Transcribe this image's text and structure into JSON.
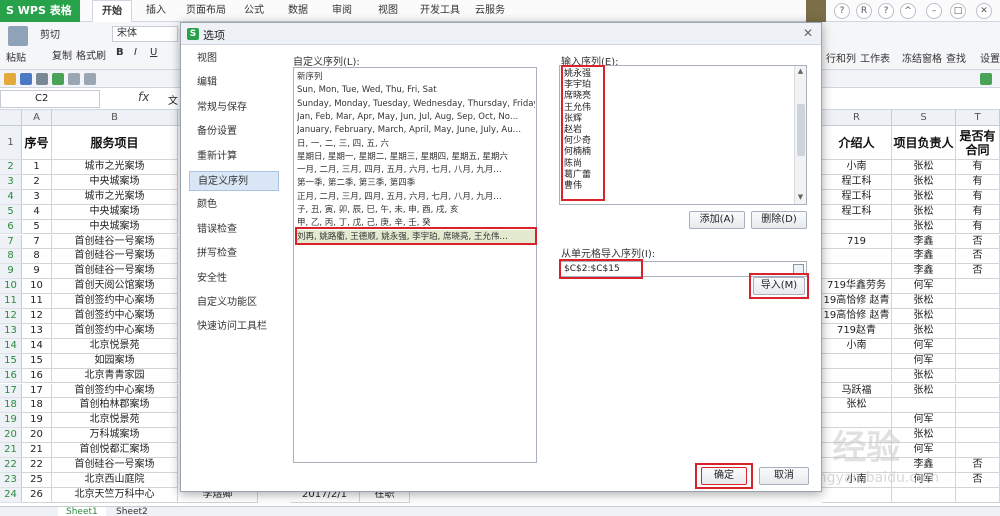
{
  "app": {
    "logo": "S WPS 表格",
    "tabs": [
      "开始",
      "插入",
      "页面布局",
      "公式",
      "数据",
      "审阅",
      "视图",
      "开发工具",
      "云服务"
    ],
    "active_tab": "开始"
  },
  "window": {
    "controls": [
      "?",
      "R",
      "?",
      "^",
      "–",
      "□",
      "✕"
    ]
  },
  "ribbon": {
    "paste": "粘贴",
    "cut": "剪切",
    "copy": "复制",
    "format_painter": "格式刷",
    "font": "宋体",
    "bold": "B",
    "italic": "I",
    "underline": "U",
    "right": [
      "行和列",
      "工作表",
      "冻结窗格",
      "查找",
      "设置"
    ]
  },
  "formula": {
    "namebox": "C2",
    "fx": "fx",
    "content": "文"
  },
  "grid": {
    "columns": [
      "A",
      "B",
      "R",
      "S",
      "T"
    ],
    "row_numbers": [
      "1",
      "2",
      "3",
      "4",
      "5",
      "6",
      "7",
      "8",
      "9",
      "10",
      "11",
      "12",
      "13",
      "14",
      "15",
      "16",
      "17",
      "18",
      "19",
      "20",
      "21",
      "22",
      "23",
      "24"
    ],
    "header": {
      "seq": "序号",
      "service": "服务项目",
      "referrer": "介绍人",
      "owner": "项目负责人",
      "contract": "是否有合同"
    },
    "rows": [
      {
        "seq": "1",
        "service": "城市之光案场",
        "ref": "小南",
        "owner": "张松",
        "c": "有"
      },
      {
        "seq": "2",
        "service": "中央城案场",
        "ref": "程工科",
        "owner": "张松",
        "c": "有"
      },
      {
        "seq": "3",
        "service": "城市之光案场",
        "ref": "程工科",
        "owner": "张松",
        "c": "有"
      },
      {
        "seq": "4",
        "service": "中央城案场",
        "ref": "程工科",
        "owner": "张松",
        "c": "有"
      },
      {
        "seq": "5",
        "service": "中央城案场",
        "ref": "",
        "owner": "张松",
        "c": "有"
      },
      {
        "seq": "7",
        "service": "首创硅谷一号案场",
        "ref": "719",
        "owner": "李鑫",
        "c": "否"
      },
      {
        "seq": "8",
        "service": "首创硅谷一号案场",
        "ref": "",
        "owner": "李鑫",
        "c": "否"
      },
      {
        "seq": "9",
        "service": "首创硅谷一号案场",
        "ref": "",
        "owner": "李鑫",
        "c": "否"
      },
      {
        "seq": "10",
        "service": "首创天阅公馆案场",
        "ref": "719华鑫劳务",
        "owner": "何军",
        "c": ""
      },
      {
        "seq": "11",
        "service": "首创签约中心案场",
        "ref": "19高恰修 赵青",
        "owner": "张松",
        "c": ""
      },
      {
        "seq": "12",
        "service": "首创签约中心案场",
        "ref": "19高恰修 赵青",
        "owner": "张松",
        "c": ""
      },
      {
        "seq": "13",
        "service": "首创签约中心案场",
        "ref": "719赵青",
        "owner": "张松",
        "c": ""
      },
      {
        "seq": "14",
        "service": "北京悦景苑",
        "ref": "小南",
        "owner": "何军",
        "c": ""
      },
      {
        "seq": "15",
        "service": "如园案场",
        "ref": "",
        "owner": "何军",
        "c": ""
      },
      {
        "seq": "16",
        "service": "北京青青家园",
        "ref": "",
        "owner": "张松",
        "c": ""
      },
      {
        "seq": "17",
        "service": "首创签约中心案场",
        "ref": "马跃福",
        "owner": "张松",
        "c": ""
      },
      {
        "seq": "18",
        "service": "首创柏林郡案场",
        "ref": "张松",
        "owner": "",
        "c": ""
      },
      {
        "seq": "19",
        "service": "北京悦景苑",
        "ref": "",
        "owner": "何军",
        "c": ""
      },
      {
        "seq": "20",
        "service": "万科城案场",
        "ref": "",
        "owner": "张松",
        "c": ""
      },
      {
        "seq": "21",
        "service": "首创悦都汇案场",
        "ref": "",
        "owner": "何军",
        "c": ""
      },
      {
        "seq": "22",
        "service": "首创硅谷一号案场",
        "ref": "",
        "owner": "李鑫",
        "c": "否"
      },
      {
        "seq": "25",
        "service": "北京西山庭院",
        "ref": "小南",
        "owner": "何军",
        "c": "否"
      },
      {
        "seq": "26",
        "service": "北京天竺万科中心",
        "ref": "",
        "owner": "",
        "c": ""
      }
    ],
    "partial_row": {
      "name": "李煜卿",
      "date": "2017/2/1",
      "status": "在职"
    }
  },
  "sheets": [
    "Sheet1",
    "Sheet2"
  ],
  "dialog": {
    "title": "选项",
    "nav": [
      "视图",
      "编辑",
      "常规与保存",
      "备份设置",
      "重新计算",
      "自定义序列",
      "颜色",
      "错误检查",
      "拼写检查",
      "安全性",
      "自定义功能区",
      "快速访问工具栏"
    ],
    "active_nav": "自定义序列",
    "custom_list_label": "自定义序列(L):",
    "custom_lists": [
      "新序列",
      "Sun, Mon, Tue, Wed, Thu, Fri, Sat",
      "Sunday, Monday, Tuesday, Wednesday, Thursday, Friday…",
      "Jan, Feb, Mar, Apr, May, Jun, Jul, Aug, Sep, Oct, No…",
      "January, February, March, April, May, June, July, Au…",
      "日, 一, 二, 三, 四, 五, 六",
      "星期日, 星期一, 星期二, 星期三, 星期四, 星期五, 星期六",
      "一月, 二月, 三月, 四月, 五月, 六月, 七月, 八月, 九月…",
      "第一季, 第二季, 第三季, 第四季",
      "正月, 二月, 三月, 四月, 五月, 六月, 七月, 八月, 九月…",
      "子, 丑, 寅, 卯, 辰, 巳, 午, 未, 申, 酉, 戌, 亥",
      "甲, 乙, 丙, 丁, 戊, 己, 庚, 辛, 壬, 癸",
      "刘再, 姚路衢, 王德顺, 姚永强, 李宇珀, 席晓亮, 王允伟…"
    ],
    "selected_list_index": 12,
    "input_label": "输入序列(E):",
    "input_values": [
      "姚永强",
      "李宇珀",
      "席晓亮",
      "王允伟",
      "张辉",
      "赵岩",
      "何少奇",
      "何楠楠",
      "陈尚",
      "葛广蕾",
      "曹伟"
    ],
    "add_label": "添加(A)",
    "delete_label": "删除(D)",
    "import_label_text": "从单元格导入序列(I):",
    "import_range": "$C$2:$C$15",
    "import_button": "导入(M)",
    "ok": "确定",
    "cancel": "取消"
  },
  "watermark": {
    "text": "Bai 经验",
    "sub": "jingyan.baidu.com"
  },
  "colors": {
    "accent": "#27a24a",
    "highlight": "#d8232a",
    "selection": "#d9e6f5"
  }
}
